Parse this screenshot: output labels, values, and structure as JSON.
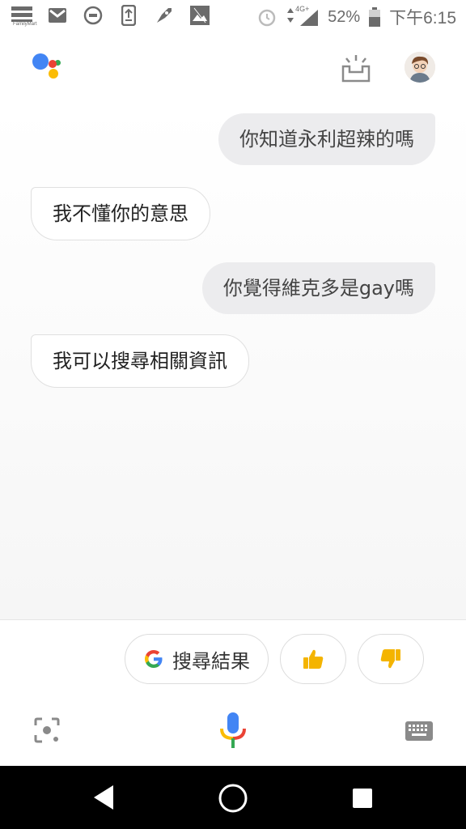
{
  "status_bar": {
    "battery_percent": "52%",
    "time": "下午6:15",
    "network": "4G+",
    "store_label": "FamilyMart",
    "icons": [
      "familymart-icon",
      "gmail-icon",
      "blocked-icon",
      "download-icon",
      "rocket-icon",
      "photo-icon",
      "alarm-icon",
      "signal-icon",
      "battery-icon"
    ]
  },
  "header": {
    "assistant_logo": "google-assistant-logo",
    "inbox_icon": "updates-inbox-icon",
    "avatar": "user-avatar"
  },
  "conversation": [
    {
      "role": "user",
      "text": "你知道永利超辣的嗎"
    },
    {
      "role": "assistant",
      "text": "我不懂你的意思"
    },
    {
      "role": "user",
      "text": "你覺得維克多是gay嗎"
    },
    {
      "role": "assistant",
      "text": "我可以搜尋相關資訊"
    }
  ],
  "suggestions": {
    "search_chip_label": "搜尋結果",
    "thumbs_up_icon": "thumbs-up-icon",
    "thumbs_down_icon": "thumbs-down-icon"
  },
  "tools": {
    "lens_icon": "lens-icon",
    "mic_icon": "microphone-icon",
    "keyboard_icon": "keyboard-icon"
  },
  "colors": {
    "google_blue": "#4285F4",
    "google_red": "#EA4335",
    "google_yellow": "#FBBC05",
    "google_green": "#34A853",
    "user_bubble": "#ececee",
    "thumbs": "#f4b400"
  }
}
